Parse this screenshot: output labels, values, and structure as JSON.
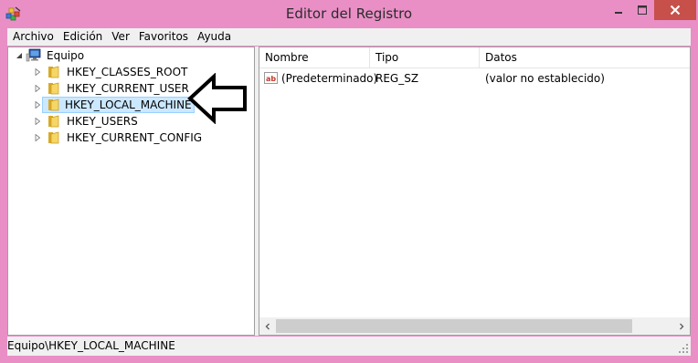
{
  "window": {
    "title": "Editor del Registro",
    "icon": "regedit-icon"
  },
  "menu": {
    "items": [
      {
        "label": "Archivo"
      },
      {
        "label": "Edición"
      },
      {
        "label": "Ver"
      },
      {
        "label": "Favoritos"
      },
      {
        "label": "Ayuda"
      }
    ]
  },
  "tree": {
    "root": {
      "label": "Equipo",
      "icon": "computer-icon",
      "expanded": true
    },
    "items": [
      {
        "label": "HKEY_CLASSES_ROOT",
        "icon": "folder-icon",
        "selected": false
      },
      {
        "label": "HKEY_CURRENT_USER",
        "icon": "folder-icon",
        "selected": false
      },
      {
        "label": "HKEY_LOCAL_MACHINE",
        "icon": "folder-icon",
        "selected": true
      },
      {
        "label": "HKEY_USERS",
        "icon": "folder-icon",
        "selected": false
      },
      {
        "label": "HKEY_CURRENT_CONFIG",
        "icon": "folder-icon",
        "selected": false
      }
    ]
  },
  "annotation": {
    "icon": "left-arrow-outline-icon",
    "points_to": "HKEY_LOCAL_MACHINE"
  },
  "list": {
    "columns": [
      "Nombre",
      "Tipo",
      "Datos"
    ],
    "rows": [
      {
        "icon": "string-value-icon",
        "nombre": "(Predeterminado)",
        "tipo": "REG_SZ",
        "datos": "(valor no establecido)"
      }
    ]
  },
  "status": {
    "path": "Equipo\\HKEY_LOCAL_MACHINE"
  },
  "colors": {
    "frame": "#e98fc6",
    "close_button": "#c7504a",
    "selection_bg": "#cce8ff",
    "selection_border": "#99d1ff"
  }
}
